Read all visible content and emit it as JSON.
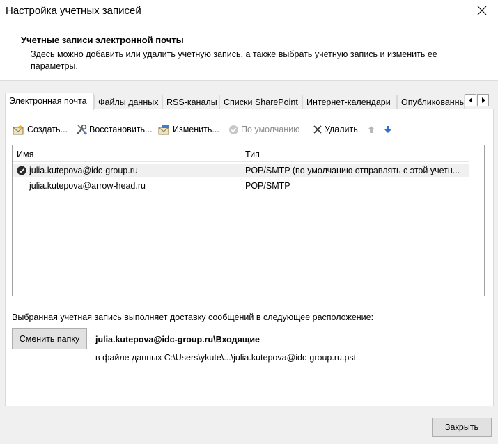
{
  "window": {
    "title": "Настройка учетных записей"
  },
  "header": {
    "title": "Учетные записи электронной почты",
    "description": "Здесь можно добавить или удалить учетную запись, а также выбрать учетную запись и изменить ее параметры."
  },
  "tabs": [
    {
      "label": "Электронная почта",
      "active": true
    },
    {
      "label": "Файлы данных"
    },
    {
      "label": "RSS-каналы"
    },
    {
      "label": "Списки SharePoint"
    },
    {
      "label": "Интернет-календари"
    },
    {
      "label": "Опубликованные календари"
    }
  ],
  "toolbar": {
    "create": "Создать...",
    "repair": "Восстановить...",
    "change": "Изменить...",
    "set_default": "По умолчанию",
    "remove": "Удалить"
  },
  "accounts_list": {
    "columns": {
      "name": "Имя",
      "type": "Тип"
    },
    "rows": [
      {
        "name": "julia.kutepova@idc-group.ru",
        "type": "POP/SMTP (по умолчанию отправлять с этой учетн...",
        "default": true,
        "selected": true
      },
      {
        "name": "julia.kutepova@arrow-head.ru",
        "type": "POP/SMTP",
        "default": false,
        "selected": false
      }
    ]
  },
  "delivery": {
    "label": "Выбранная учетная запись выполняет доставку сообщений в следующее расположение:",
    "change_folder_button": "Сменить папку",
    "folder": "julia.kutepova@idc-group.ru\\Входящие",
    "data_file": "в файле данных C:\\Users\\ykute\\...\\julia.kutepova@idc-group.ru.pst"
  },
  "footer": {
    "close_button": "Закрыть"
  }
}
